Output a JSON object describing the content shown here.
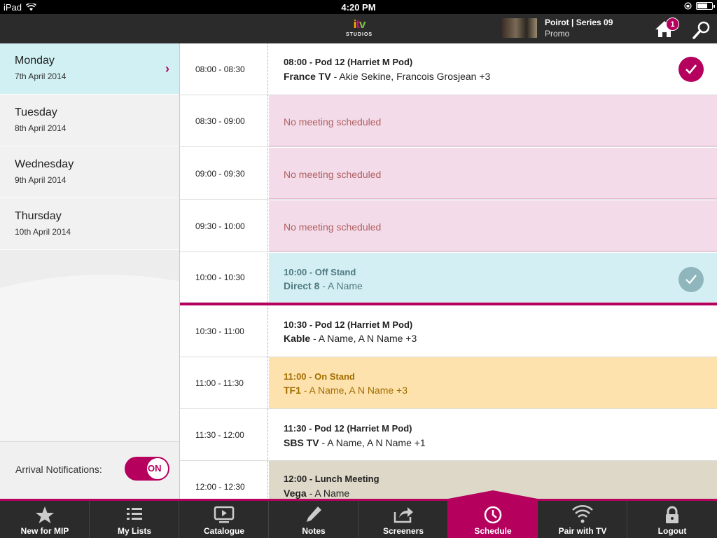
{
  "status": {
    "carrier": "iPad",
    "time": "4:20 PM",
    "battery_level": 0.7
  },
  "header": {
    "logo_text": "itv",
    "logo_sub": "STUDIOS",
    "show_title": "Poirot  |  Series 09",
    "show_sub": "Promo",
    "notification_count": "1"
  },
  "sidebar": {
    "days": [
      {
        "name": "Monday",
        "date": "7th April 2014",
        "active": true
      },
      {
        "name": "Tuesday",
        "date": "8th April 2014"
      },
      {
        "name": "Wednesday",
        "date": "9th April 2014"
      },
      {
        "name": "Thursday",
        "date": "10th April 2014"
      }
    ],
    "notifications_label": "Arrival Notifications:",
    "notifications_toggle": "ON"
  },
  "schedule": {
    "rows": [
      {
        "time": "08:00 - 08:30",
        "type": "meeting",
        "title": "08:00 - Pod 12 (Harriet M Pod)",
        "company": "France TV",
        "attendees": " - Akie Sekine, Francois Grosjean +3",
        "checked": true
      },
      {
        "time": "08:30 - 09:00",
        "type": "empty",
        "text": "No meeting scheduled"
      },
      {
        "time": "09:00 - 09:30",
        "type": "empty",
        "text": "No meeting scheduled"
      },
      {
        "time": "09:30 - 10:00",
        "type": "empty",
        "text": "No meeting scheduled"
      },
      {
        "time": "10:00 - 10:30",
        "type": "past",
        "title": "10:00 - Off Stand",
        "company": "Direct 8",
        "attendees": " - A Name",
        "checked": true
      },
      {
        "time": "10:30 - 11:00",
        "type": "meeting",
        "title": "10:30 - Pod 12 (Harriet M Pod)",
        "company": "Kable",
        "attendees": " - A Name, A N Name +3"
      },
      {
        "time": "11:00 - 11:30",
        "type": "onstand",
        "title": "11:00 - On Stand",
        "company": "TF1",
        "attendees": " - A Name, A N Name +3"
      },
      {
        "time": "11:30 - 12:00",
        "type": "meeting",
        "title": "11:30 - Pod 12 (Harriet M Pod)",
        "company": "SBS TV",
        "attendees": " - A Name, A N Name +1"
      },
      {
        "time": "12:00 - 12:30",
        "type": "lunch",
        "title": "12:00 - Lunch Meeting",
        "company": "Vega",
        "attendees": " - A Name"
      }
    ]
  },
  "tabs": [
    {
      "label": "New for MIP",
      "icon": "star-icon"
    },
    {
      "label": "My Lists",
      "icon": "list-icon"
    },
    {
      "label": "Catalogue",
      "icon": "monitor-play-icon"
    },
    {
      "label": "Notes",
      "icon": "pencil-icon"
    },
    {
      "label": "Screeners",
      "icon": "share-icon"
    },
    {
      "label": "Schedule",
      "icon": "clock-icon",
      "active": true
    },
    {
      "label": "Pair with TV",
      "icon": "wifi-icon"
    },
    {
      "label": "Logout",
      "icon": "lock-icon"
    }
  ],
  "colors": {
    "accent": "#b5005e",
    "header": "#2b2b2b",
    "empty_slot": "#f3dbe9",
    "past_slot": "#d3eff3",
    "onstand_slot": "#fde2ad",
    "lunch_slot": "#ddd8c7"
  }
}
